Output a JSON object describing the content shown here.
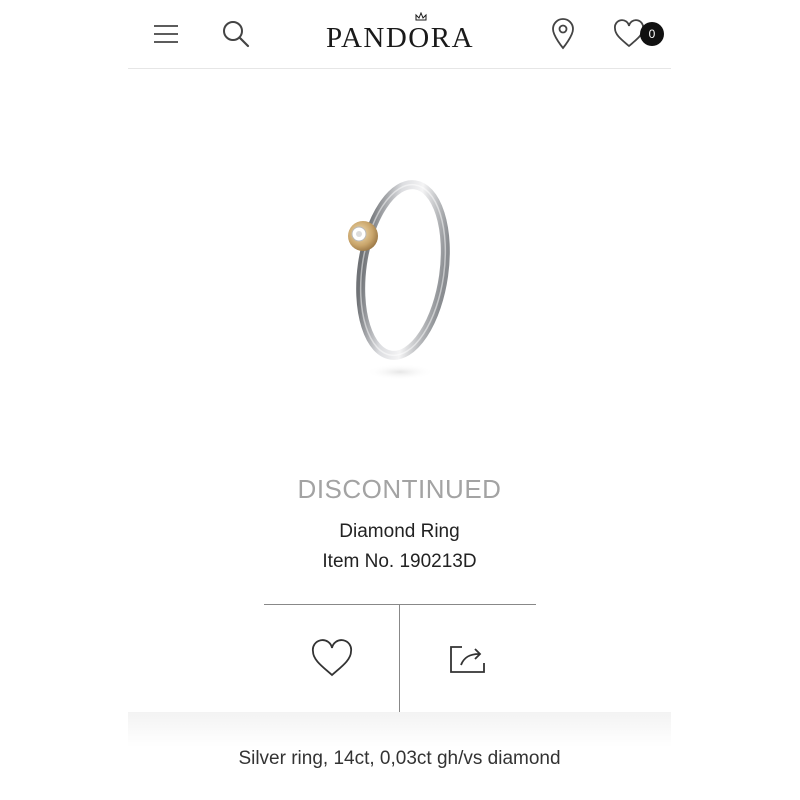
{
  "header": {
    "brand": "PANDORA",
    "icons": {
      "menu": "hamburger-menu-icon",
      "search": "search-icon",
      "store": "location-pin-icon",
      "wishlist": "heart-icon"
    },
    "wishlist_count": "0"
  },
  "product": {
    "image": "silver-diamond-ring-image",
    "status": "DISCONTINUED",
    "name": "Diamond Ring",
    "item_no": "Item No. 190213D",
    "description": "Silver ring, 14ct, 0,03ct gh/vs diamond"
  },
  "actions": {
    "favorite_icon": "heart-outline-icon",
    "share_icon": "share-icon"
  },
  "colors": {
    "status_text": "#a3a3a3",
    "badge": "#111111",
    "divider": "#888888"
  }
}
